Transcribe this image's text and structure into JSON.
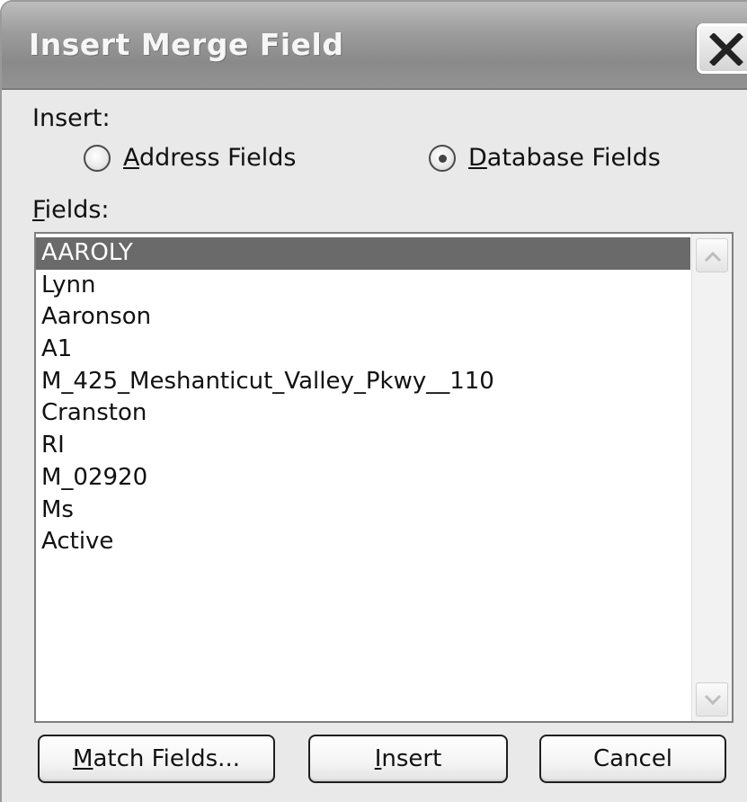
{
  "window": {
    "title": "Insert Merge Field",
    "close_icon": "close-icon"
  },
  "insert_group": {
    "label": "Insert:",
    "options": [
      {
        "mnemonic": "A",
        "rest": "ddress Fields",
        "checked": false
      },
      {
        "mnemonic": "D",
        "rest": "atabase Fields",
        "checked": true
      }
    ]
  },
  "fields": {
    "label_mnemonic": "F",
    "label_rest": "ields:",
    "items": [
      "AAROLY",
      "Lynn",
      "Aaronson",
      "A1",
      "M_425_Meshanticut_Valley_Pkwy__110",
      "Cranston",
      "RI",
      "M_02920",
      "Ms",
      "Active"
    ],
    "selected_index": 0
  },
  "buttons": {
    "match_mnemonic": "M",
    "match_rest": "atch Fields...",
    "insert_mnemonic": "I",
    "insert_rest": "nsert",
    "cancel_label": "Cancel"
  },
  "icons": {
    "scroll_up": "chevron-up-icon",
    "scroll_down": "chevron-down-icon"
  }
}
